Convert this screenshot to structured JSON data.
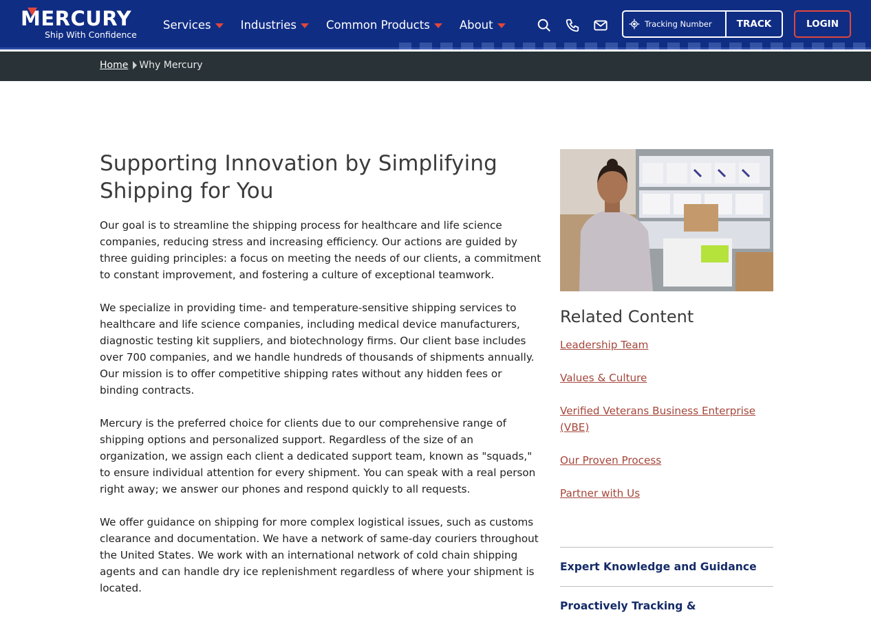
{
  "brand": {
    "name": "MERCURY",
    "tagline": "Ship With Confidence",
    "accent_color": "#e0473c",
    "header_color": "#102d84"
  },
  "nav": {
    "items": [
      {
        "label": "Services",
        "icon": "caret-down-icon"
      },
      {
        "label": "Industries",
        "icon": "caret-down-icon"
      },
      {
        "label": "Common Products",
        "icon": "caret-down-icon"
      },
      {
        "label": "About",
        "icon": "caret-down-icon"
      }
    ],
    "icons": [
      "search-icon",
      "phone-icon",
      "mail-icon"
    ]
  },
  "tracking": {
    "placeholder": "Tracking Number",
    "button_label": "TRACK",
    "icon": "crosshair-icon"
  },
  "login": {
    "label": "LOGIN"
  },
  "breadcrumb": {
    "home": "Home",
    "current": "Why Mercury"
  },
  "main": {
    "title": "Supporting Innovation by Simplifying Shipping for You",
    "paragraphs": [
      "Our goal is to streamline the shipping process for healthcare and life science companies, reducing stress and increasing efficiency. Our actions are guided by three guiding principles: a focus on meeting the needs of our clients, a commitment to constant improvement, and fostering a culture of exceptional teamwork.",
      "We specialize in providing time- and temperature-sensitive shipping services to healthcare and life science companies, including medical device manufacturers, diagnostic testing kit suppliers, and biotechnology firms. Our client base includes over 700 companies, and we handle hundreds of thousands of shipments annually. Our mission is to offer competitive shipping rates without any hidden fees or binding contracts.",
      "Mercury is the preferred choice for clients due to our comprehensive range of shipping options and personalized support. Regardless of the size of an organization, we assign each client a dedicated support team, known as \"squads,\" to ensure individual attention for every shipment. You can speak with a real person right away; we answer our phones and respond quickly to all requests.",
      "We offer guidance on shipping for more complex logistical issues, such as customs clearance and documentation. We have a network of same-day couriers throughout the United States. We work with an international network of cold chain shipping agents and can handle dry ice replenishment regardless of where your shipment is located."
    ]
  },
  "sidebar": {
    "related_title": "Related Content",
    "links": [
      "Leadership Team",
      "Values & Culture",
      "Verified Veterans Business Enterprise (VBE)",
      "Our Proven Process",
      "Partner with Us"
    ],
    "link_color": "#a5463a",
    "accordion": [
      "Expert Knowledge and Guidance",
      "Proactively Tracking &"
    ]
  }
}
